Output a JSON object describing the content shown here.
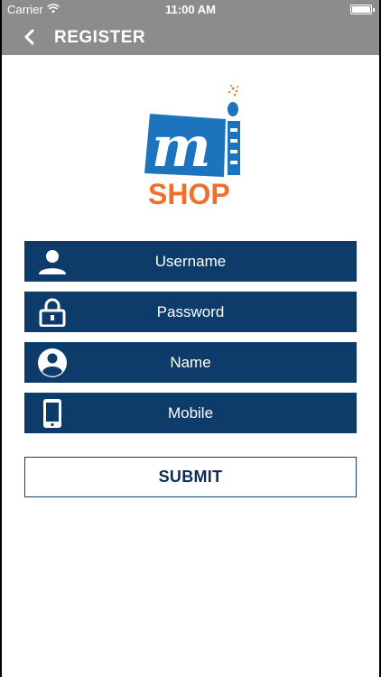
{
  "status_bar": {
    "carrier": "Carrier",
    "time": "11:00 AM"
  },
  "nav": {
    "title": "REGISTER",
    "back_icon": "chevron-left-icon"
  },
  "logo": {
    "brand_text": "SHOP",
    "mark_letter": "m"
  },
  "form": {
    "fields": [
      {
        "placeholder": "Username",
        "icon": "user-icon"
      },
      {
        "placeholder": "Password",
        "icon": "lock-icon"
      },
      {
        "placeholder": "Name",
        "icon": "account-circle-icon"
      },
      {
        "placeholder": "Mobile",
        "icon": "phone-icon"
      }
    ],
    "submit_label": "SUBMIT"
  },
  "colors": {
    "nav_bg": "#8c8c8c",
    "field_bg": "#0d3b6a",
    "logo_blue": "#1c75bc",
    "logo_orange": "#f0702b",
    "submit_text": "#0d2c55"
  }
}
